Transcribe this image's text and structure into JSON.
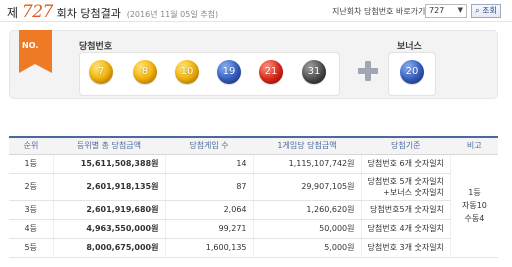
{
  "header": {
    "prefix": "제",
    "round": "727",
    "suffix": "회차 당첨결과",
    "date": "(2016년 11월 05일 추첨)",
    "nav_label": "지난회차 당첨번호 바로가기",
    "select_value": "727",
    "view_button": "조회"
  },
  "winning": {
    "badge": "NO.",
    "main_label": "당첨번호",
    "numbers": [
      "7",
      "8",
      "10",
      "19",
      "21",
      "31"
    ],
    "bonus_label": "보너스",
    "bonus": "20"
  },
  "table": {
    "headers": [
      "순위",
      "등위별 총 당첨금액",
      "당첨게임 수",
      "1게임당 당첨금액",
      "당첨기준",
      "비고"
    ],
    "rows": [
      {
        "rank": "1등",
        "total": "15,611,508,388원",
        "count": "14",
        "per_game": "1,115,107,742원",
        "criteria": [
          "당첨번호 6개 숫자일치"
        ]
      },
      {
        "rank": "2등",
        "total": "2,601,918,135원",
        "count": "87",
        "per_game": "29,907,105원",
        "criteria": [
          "당첨번호 5개 숫자일치",
          "+보너스 숫자일치"
        ]
      },
      {
        "rank": "3등",
        "total": "2,601,919,680원",
        "count": "2,064",
        "per_game": "1,260,620원",
        "criteria": [
          "당첨번호5개 숫자일치"
        ]
      },
      {
        "rank": "4등",
        "total": "4,963,550,000원",
        "count": "99,271",
        "per_game": "50,000원",
        "criteria": [
          "당첨번호 4개 숫자일치"
        ]
      },
      {
        "rank": "5등",
        "total": "8,000,675,000원",
        "count": "1,600,135",
        "per_game": "5,000원",
        "criteria": [
          "당첨번호 3개 숫자일치"
        ]
      }
    ],
    "note_lines": [
      "1등",
      "자동10",
      "수동4"
    ]
  }
}
